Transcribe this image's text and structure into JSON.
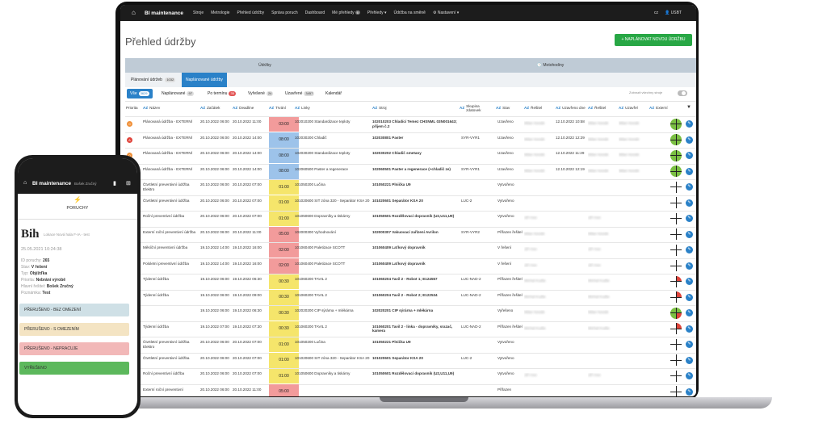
{
  "nav": {
    "brand": "BI maintenance",
    "items": [
      "Stroje",
      "Metrologie",
      "Přehled údržby",
      "Správa poruch",
      "Dashboard",
      "Mé přehledy",
      "Přehledy ▾",
      "Údržba na směně",
      "⚙ Nastavení ▾"
    ],
    "my_count": "6",
    "lang": "cz",
    "user": "👤 USBT"
  },
  "page": {
    "title": "Přehled údržby",
    "new_button": "+ NAPLÁNOVAT NOVOU ÚDRŽBU"
  },
  "groups": {
    "left": "Údržby",
    "right": "🕓 Motohodiny"
  },
  "subtabs": [
    {
      "label": "Plánování údržeb",
      "count": "1032"
    },
    {
      "label": "Naplánované údržby",
      "count": ""
    }
  ],
  "filters": [
    {
      "label": "Vše",
      "count": "3629"
    },
    {
      "label": "Naplánované",
      "count": "97"
    },
    {
      "label": "Po termínu",
      "count": "35"
    },
    {
      "label": "Vyřešené",
      "count": "24"
    },
    {
      "label": "Uzavřené",
      "count": "3457"
    },
    {
      "label": "Kalendář",
      "count": ""
    }
  ],
  "toggle_label": "Zobrazit všechny stroje",
  "columns": [
    "Priorita",
    "Název",
    "Začátek",
    "Deadline",
    "Trvání",
    "Linky",
    "Stroj",
    "Skupina zdatovek",
    "Stav",
    "Řešitel",
    "Uzavřeno dne",
    "Řešitel",
    "Uzavřel",
    "Externí"
  ],
  "rows": [
    {
      "prio": "0",
      "pc": "#f0913a",
      "name": "Plánovaná údržba - EXTERNÍ",
      "start": "20.10.2022 06:00",
      "deadline": "20.10.2022 11:00",
      "dur": "03:00",
      "dc": "#f29b9b",
      "line": "102010200 Standardizace teploty",
      "machine": "102010203 Chladící Temez CHSNML 03N001643; příjem č.2",
      "grp": "",
      "state": "Uzavřeno",
      "r1": "Milan Novák",
      "closed": "12.10.2022 10:58",
      "r2": "Milan Novák",
      "cl": "Milan Novák",
      "g": "green"
    },
    {
      "prio": "A",
      "pc": "#e0453c",
      "name": "Plánovaná údržba - EXTERNÍ",
      "start": "20.10.2022 06:00",
      "deadline": "20.10.2022 14:00",
      "dur": "08:00",
      "dc": "#9dc3ea",
      "line": "102030200 Chladič",
      "machine": "102030801 Paster",
      "grp": "SYR-VYR1",
      "state": "Uzavřeno",
      "r1": "Milan Novák",
      "closed": "12.10.2022 12:29",
      "r2": "Milan Novák",
      "cl": "Milan Novák",
      "g": "green"
    },
    {
      "prio": "0",
      "pc": "#f0913a",
      "name": "Plánovaná údržba - EXTERNÍ",
      "start": "20.10.2022 06:00",
      "deadline": "20.10.2022 14:00",
      "dur": "08:00",
      "dc": "#9dc3ea",
      "line": "102030200 Standardizace teploty",
      "machine": "102030202 Chladič smetany",
      "grp": "",
      "state": "Uzavřeno",
      "r1": "Milan Novák",
      "closed": "12.10.2022 11:29",
      "r2": "Milan Novák",
      "cl": "Milan Novák",
      "g": "green"
    },
    {
      "prio": "0",
      "pc": "#f0913a",
      "name": "Plánovaná údržba - EXTERNÍ",
      "start": "20.10.2022 06:00",
      "deadline": "20.10.2022 14:00",
      "dur": "08:00",
      "dc": "#9dc3ea",
      "line": "102060500 Paster a regenerace",
      "machine": "102060501 Paster a regenerace (+chladič ze)",
      "grp": "SYR-VYR1",
      "state": "Uzavřeno",
      "r1": "Milan Novák",
      "closed": "12.10.2022 12:19",
      "r2": "Milan Novák",
      "cl": "Milan Novák",
      "g": "green"
    },
    {
      "prio": "",
      "pc": "",
      "name": "Čtvrtletní preventivní údržba Elektro",
      "start": "20.10.2022 06:00",
      "deadline": "20.10.2022 07:00",
      "dur": "01:00",
      "dc": "#f5e56b",
      "line": "101050200 Lučina",
      "machine": "101050221 Plnička U9",
      "grp": "",
      "state": "Vytvořeno",
      "r1": "",
      "closed": "",
      "r2": "",
      "cl": "",
      "g": "white"
    },
    {
      "prio": "",
      "pc": "",
      "name": "Čtvrtletní preventivní údržba",
      "start": "20.10.2022 06:00",
      "deadline": "20.10.2022 07:00",
      "dur": "01:00",
      "dc": "#f5e56b",
      "line": "101020600 SIT zóna 320 - Separátor KSA 20",
      "machine": "101020601 Separátor KSA 20",
      "grp": "LUC-2",
      "state": "Vytvořeno",
      "r1": "",
      "closed": "",
      "r2": "",
      "cl": "",
      "g": "white"
    },
    {
      "prio": "",
      "pc": "",
      "name": "Roční preventivní údržba",
      "start": "20.10.2022 06:00",
      "deadline": "20.10.2022 07:00",
      "dur": "01:00",
      "dc": "#f5e56b",
      "line": "101050600 Dopravníky a tiskárny",
      "machine": "101050601 Rozdělovací dopravník (U2,U11,U9)",
      "grp": "",
      "state": "Vytvořeno",
      "r1": "Jiří Hon",
      "closed": "",
      "r2": "Jiří Hon",
      "cl": "",
      "g": "white"
    },
    {
      "prio": "",
      "pc": "",
      "name": "Externí roční preventivní údržba",
      "start": "20.10.2022 06:00",
      "deadline": "20.10.2022 11:00",
      "dur": "05:00",
      "dc": "#f29b9b",
      "line": "102000300 Vyhodnování",
      "machine": "102000307 Vakuovací zařízení Avrilon",
      "grp": "SYR-VYR2",
      "state": "Přiřazen řešitel",
      "r1": "Milan Novák",
      "closed": "",
      "r2": "Milan Novák",
      "cl": "",
      "g": "white"
    },
    {
      "prio": "",
      "pc": "",
      "name": "Měsíční preventivní údržba",
      "start": "19.10.2022 14:00",
      "deadline": "19.10.2022 16:00",
      "dur": "02:00",
      "dc": "#f29b9b",
      "line": "101060400 Paletizace SCOTT",
      "machine": "101060409 Laťkový dopravník",
      "grp": "",
      "state": "V řešení",
      "r1": "Jiří Hon",
      "closed": "",
      "r2": "Jiří Hon",
      "cl": "",
      "g": "white"
    },
    {
      "prio": "",
      "pc": "",
      "name": "Pololetní preventivní údržba",
      "start": "19.10.2022 14:00",
      "deadline": "19.10.2022 16:00",
      "dur": "02:00",
      "dc": "#f29b9b",
      "line": "101060400 Paletizace SCOTT",
      "machine": "101060409 Laťkový dopravník",
      "grp": "",
      "state": "V řešení",
      "r1": "Jiří Hon",
      "closed": "",
      "r2": "Jiří Hon",
      "cl": "",
      "g": "white"
    },
    {
      "prio": "",
      "pc": "",
      "name": "Týdenní údržba",
      "start": "19.10.2022 06:00",
      "deadline": "19.10.2022 06:30",
      "dur": "00:30",
      "dc": "#f5e56b",
      "line": "101060200 TAVIL 2",
      "machine": "101060204 Tavil 2 - Robot 1; E124557",
      "grp": "LUC-NAD-2",
      "state": "Přiřazen řešitel",
      "r1": "Michal Kudla",
      "closed": "",
      "r2": "Michal Kudla",
      "cl": "",
      "g": "red"
    },
    {
      "prio": "",
      "pc": "",
      "name": "Týdenní údržba",
      "start": "19.10.2022 06:00",
      "deadline": "19.10.2022 09:00",
      "dur": "00:30",
      "dc": "#f5e56b",
      "line": "101060200 TAVIL 2",
      "machine": "101060204 Tavil 2 - Robot 2; E122534",
      "grp": "LUC-NAD-2",
      "state": "Přiřazen řešitel",
      "r1": "Michal Kudla",
      "closed": "",
      "r2": "Michal Kudla",
      "cl": "",
      "g": "red"
    },
    {
      "prio": "",
      "pc": "",
      "name": "",
      "start": "19.10.2022 06:00",
      "deadline": "19.10.2022 06:30",
      "dur": "00:30",
      "dc": "#f5e56b",
      "line": "102020200 CIP sýrárna + mlékárna",
      "machine": "102020201 CIP sýrárna + mlékárna",
      "grp": "",
      "state": "Vyřešeno",
      "r1": "Milan Novák",
      "closed": "",
      "r2": "Milan Novák",
      "cl": "",
      "g": "mixed"
    },
    {
      "prio": "",
      "pc": "",
      "name": "Týdenní údržba",
      "start": "19.10.2022 07:00",
      "deadline": "19.10.2022 07:30",
      "dur": "00:30",
      "dc": "#f5e56b",
      "line": "101060200 TAVIL 2",
      "machine": "101060201 Tavil 2 - linka - dopravníky, srazač, kamera",
      "grp": "LUC-NAD-2",
      "state": "Přiřazen řešitel",
      "r1": "Michal Kudla",
      "closed": "",
      "r2": "Michal Kudla",
      "cl": "",
      "g": "red"
    },
    {
      "prio": "",
      "pc": "",
      "name": "Čtvrtletní preventivní údržba Elektro",
      "start": "20.10.2022 06:00",
      "deadline": "20.10.2022 07:00",
      "dur": "01:00",
      "dc": "#f5e56b",
      "line": "101050200 Lučina",
      "machine": "101050221 Plnička U9",
      "grp": "",
      "state": "Vytvořeno",
      "r1": "",
      "closed": "",
      "r2": "",
      "cl": "",
      "g": "white"
    },
    {
      "prio": "",
      "pc": "",
      "name": "Čtvrtletní preventivní údržba",
      "start": "20.10.2022 06:00",
      "deadline": "20.10.2022 07:00",
      "dur": "01:00",
      "dc": "#f5e56b",
      "line": "101020600 SIT zóna 320 - Separátor KSA 20",
      "machine": "101020601 Separátor KSA 20",
      "grp": "LUC-2",
      "state": "Vytvořeno",
      "r1": "",
      "closed": "",
      "r2": "",
      "cl": "",
      "g": "white"
    },
    {
      "prio": "",
      "pc": "",
      "name": "Roční preventivní údržba",
      "start": "20.10.2022 06:00",
      "deadline": "20.10.2022 07:00",
      "dur": "01:00",
      "dc": "#f5e56b",
      "line": "101050600 Dopravníky a tiskárny",
      "machine": "101050601 Rozdělovací dopravník (U2,U11,U9)",
      "grp": "",
      "state": "Vytvořeno",
      "r1": "Jiří Hon",
      "closed": "",
      "r2": "Jiří Hon",
      "cl": "",
      "g": "white"
    },
    {
      "prio": "",
      "pc": "",
      "name": "Externí roční preventivní",
      "start": "20.10.2022 06:00",
      "deadline": "20.10.2022 11:00",
      "dur": "05:00",
      "dc": "#f29b9b",
      "line": "",
      "machine": "",
      "grp": "",
      "state": "Přiřazen",
      "r1": "",
      "closed": "",
      "r2": "",
      "cl": "",
      "g": "white"
    }
  ],
  "phone": {
    "brand": "BI maintenance",
    "user": "Bošek Zručný",
    "section": "PORUCHY",
    "title": "Bih",
    "subtitle": "Lokace Nová hala F-IA - test",
    "date": "25.05.2021 10:24:38",
    "info": [
      {
        "k": "ID poruchy:",
        "v": "265"
      },
      {
        "k": "Stav:",
        "v": "V řešení"
      },
      {
        "k": "Typ:",
        "v": "Objížďka"
      },
      {
        "k": "Priorita:",
        "v": "Nebrání výrobě"
      },
      {
        "k": "Hlavní řešitel:",
        "v": "Bošek Zručný"
      },
      {
        "k": "Poznámka:",
        "v": "Test"
      }
    ],
    "buttons": [
      {
        "label": "PŘERUŠENO - BEZ OMEZENÍ",
        "color": "#cfe0e6"
      },
      {
        "label": "PŘERUŠENO - S OMEZENÍM",
        "color": "#f4e4c3"
      },
      {
        "label": "PŘERUŠENO - NEPRACUJE",
        "color": "#f2b8b8"
      },
      {
        "label": "VYŘEŠENO",
        "color": "#5cb85c"
      }
    ]
  }
}
